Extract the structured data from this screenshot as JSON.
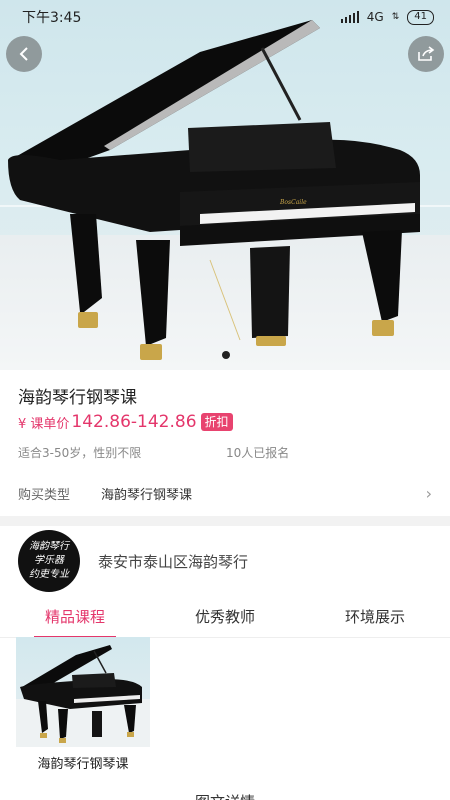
{
  "status_bar": {
    "time": "下午3:45",
    "network": "4G",
    "battery": "41"
  },
  "hero": {
    "active_slide": 1,
    "slide_count": 1,
    "piano_brand": "BosCaile"
  },
  "course": {
    "title": "海韵琴行钢琴课",
    "price_label": "¥ 课单价",
    "price": "142.86-142.86",
    "discount_badge": "折扣",
    "audience": "适合3-50岁，性别不限",
    "enrolled": "10人已报名"
  },
  "purchase": {
    "label": "购买类型",
    "value": "海韵琴行钢琴课"
  },
  "store": {
    "name": "泰安市泰山区海韵琴行",
    "logo_lines": [
      "海韵琴行",
      "学乐器",
      "约吏专业"
    ]
  },
  "tabs": [
    {
      "label": "精品课程",
      "active": true
    },
    {
      "label": "优秀教师",
      "active": false
    },
    {
      "label": "环境展示",
      "active": false
    }
  ],
  "courses": [
    {
      "caption": "海韵琴行钢琴课"
    }
  ],
  "bottom": {
    "heading": "图文详情"
  },
  "colors": {
    "accent": "#e4366b",
    "badge": "#e8436f",
    "separator": "#f2f2f2"
  }
}
